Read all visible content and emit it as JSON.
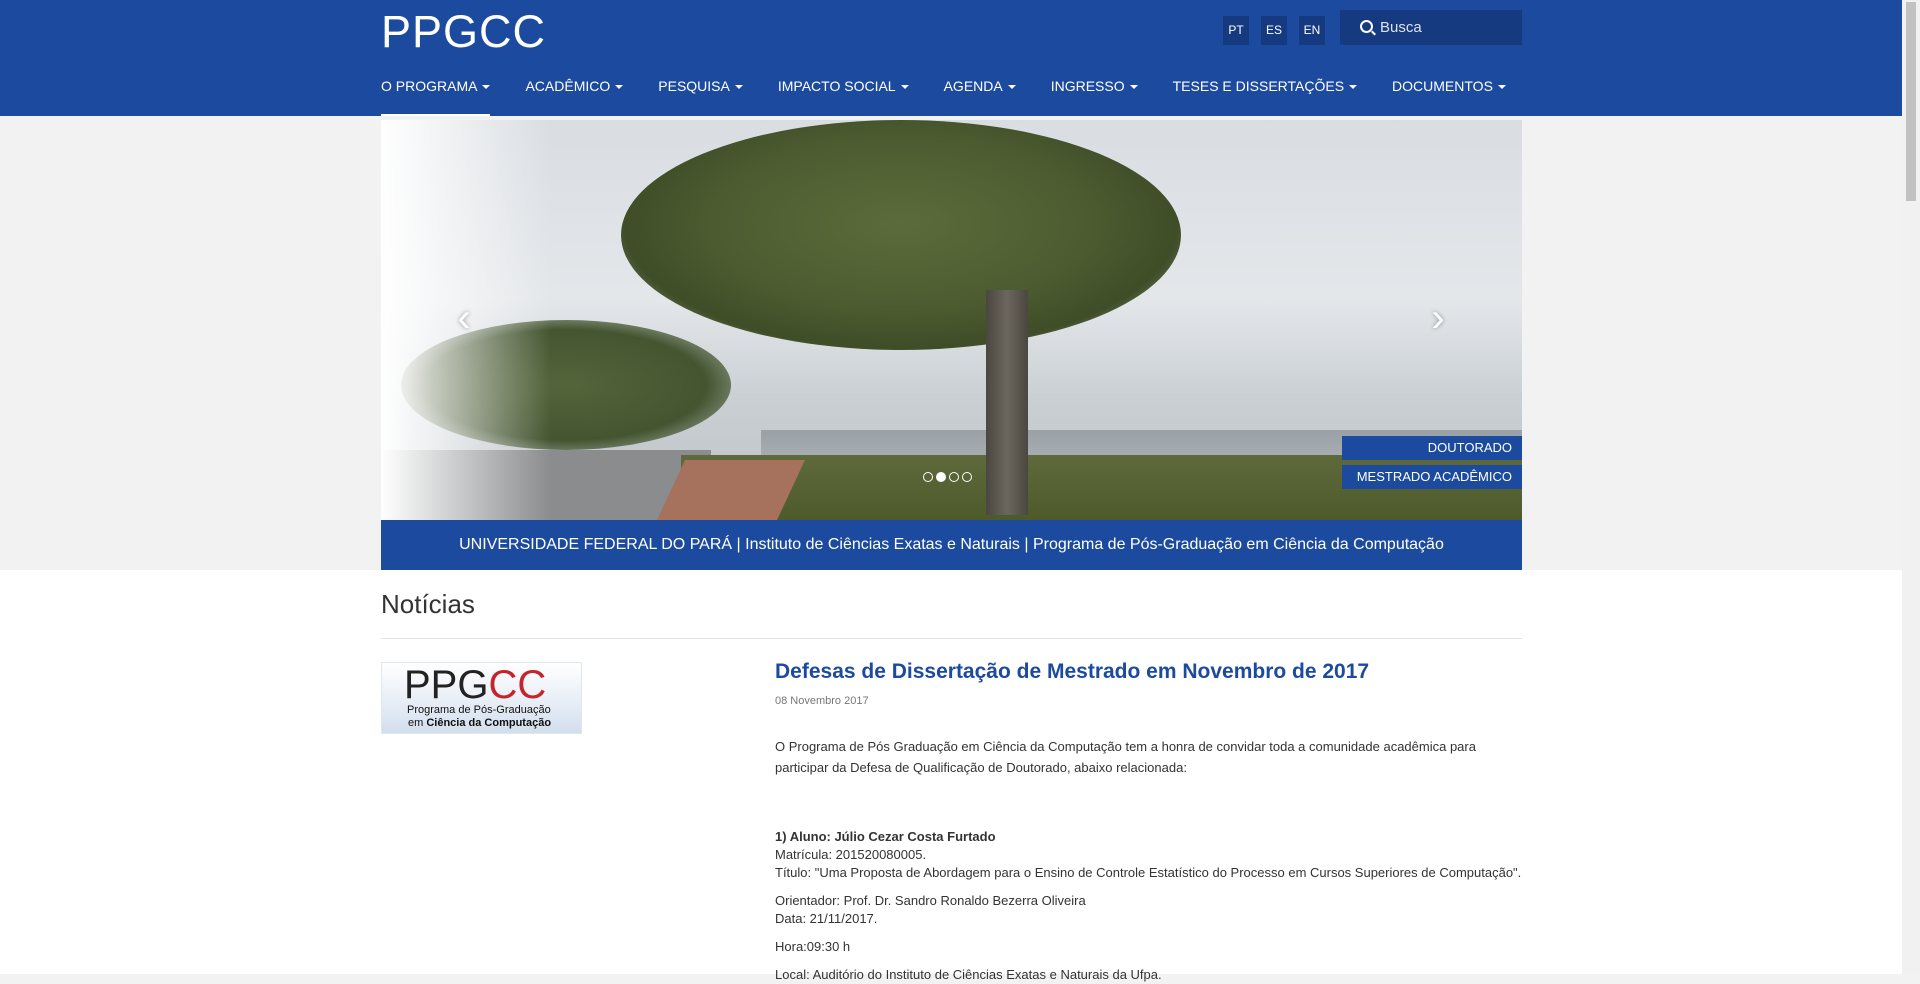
{
  "header": {
    "logo": "PPGCC",
    "languages": [
      "PT",
      "ES",
      "EN"
    ],
    "search_placeholder": "Busca"
  },
  "nav": {
    "items": [
      "O PROGRAMA",
      "ACADÊMICO",
      "PESQUISA",
      "IMPACTO SOCIAL",
      "AGENDA",
      "INGRESSO",
      "TESES E DISSERTAÇÕES",
      "DOCUMENTOS"
    ],
    "active": "O PROGRAMA"
  },
  "hero": {
    "tags": [
      "DOUTORADO",
      "MESTRADO ACADÊMICO"
    ],
    "slide_count": 4,
    "active_slide": 2,
    "banner": "UNIVERSIDADE FEDERAL DO PARÁ | Instituto de Ciências Exatas e Naturais | Programa de Pós-Graduação em Ciência da Computação"
  },
  "news": {
    "section_title": "Notícias",
    "logo_text": {
      "main_black": "PPG",
      "main_red": "CC",
      "line1": "Programa de Pós-Graduação",
      "line2_prefix": "em ",
      "line2_bold": "Ciência da Computação"
    },
    "article": {
      "title": "Defesas de Dissertação de Mestrado em Novembro de 2017",
      "date": "08 Novembro 2017",
      "intro": "O Programa de Pós Graduação em Ciência da Computação tem a honra de convidar toda a comunidade acadêmica para participar da Defesa de Qualificação de Doutorado, abaixo relacionada:",
      "student": "1) Aluno: Júlio Cezar Costa Furtado",
      "matricula": "Matrícula: 201520080005.",
      "titulo": "Título: \"Uma Proposta de Abordagem para o Ensino de Controle Estatístico do Processo em Cursos Superiores de Computação\".",
      "orientador": "Orientador: Prof. Dr. Sandro Ronaldo Bezerra Oliveira",
      "data": "Data: 21/11/2017.",
      "hora": "Hora:09:30 h",
      "local": "Local: Auditório  do Instituto de Ciências Exatas e Naturais da Ufpa."
    }
  },
  "colors": {
    "brand_blue": "#1b4a9e",
    "accent_red": "#c4242b"
  }
}
